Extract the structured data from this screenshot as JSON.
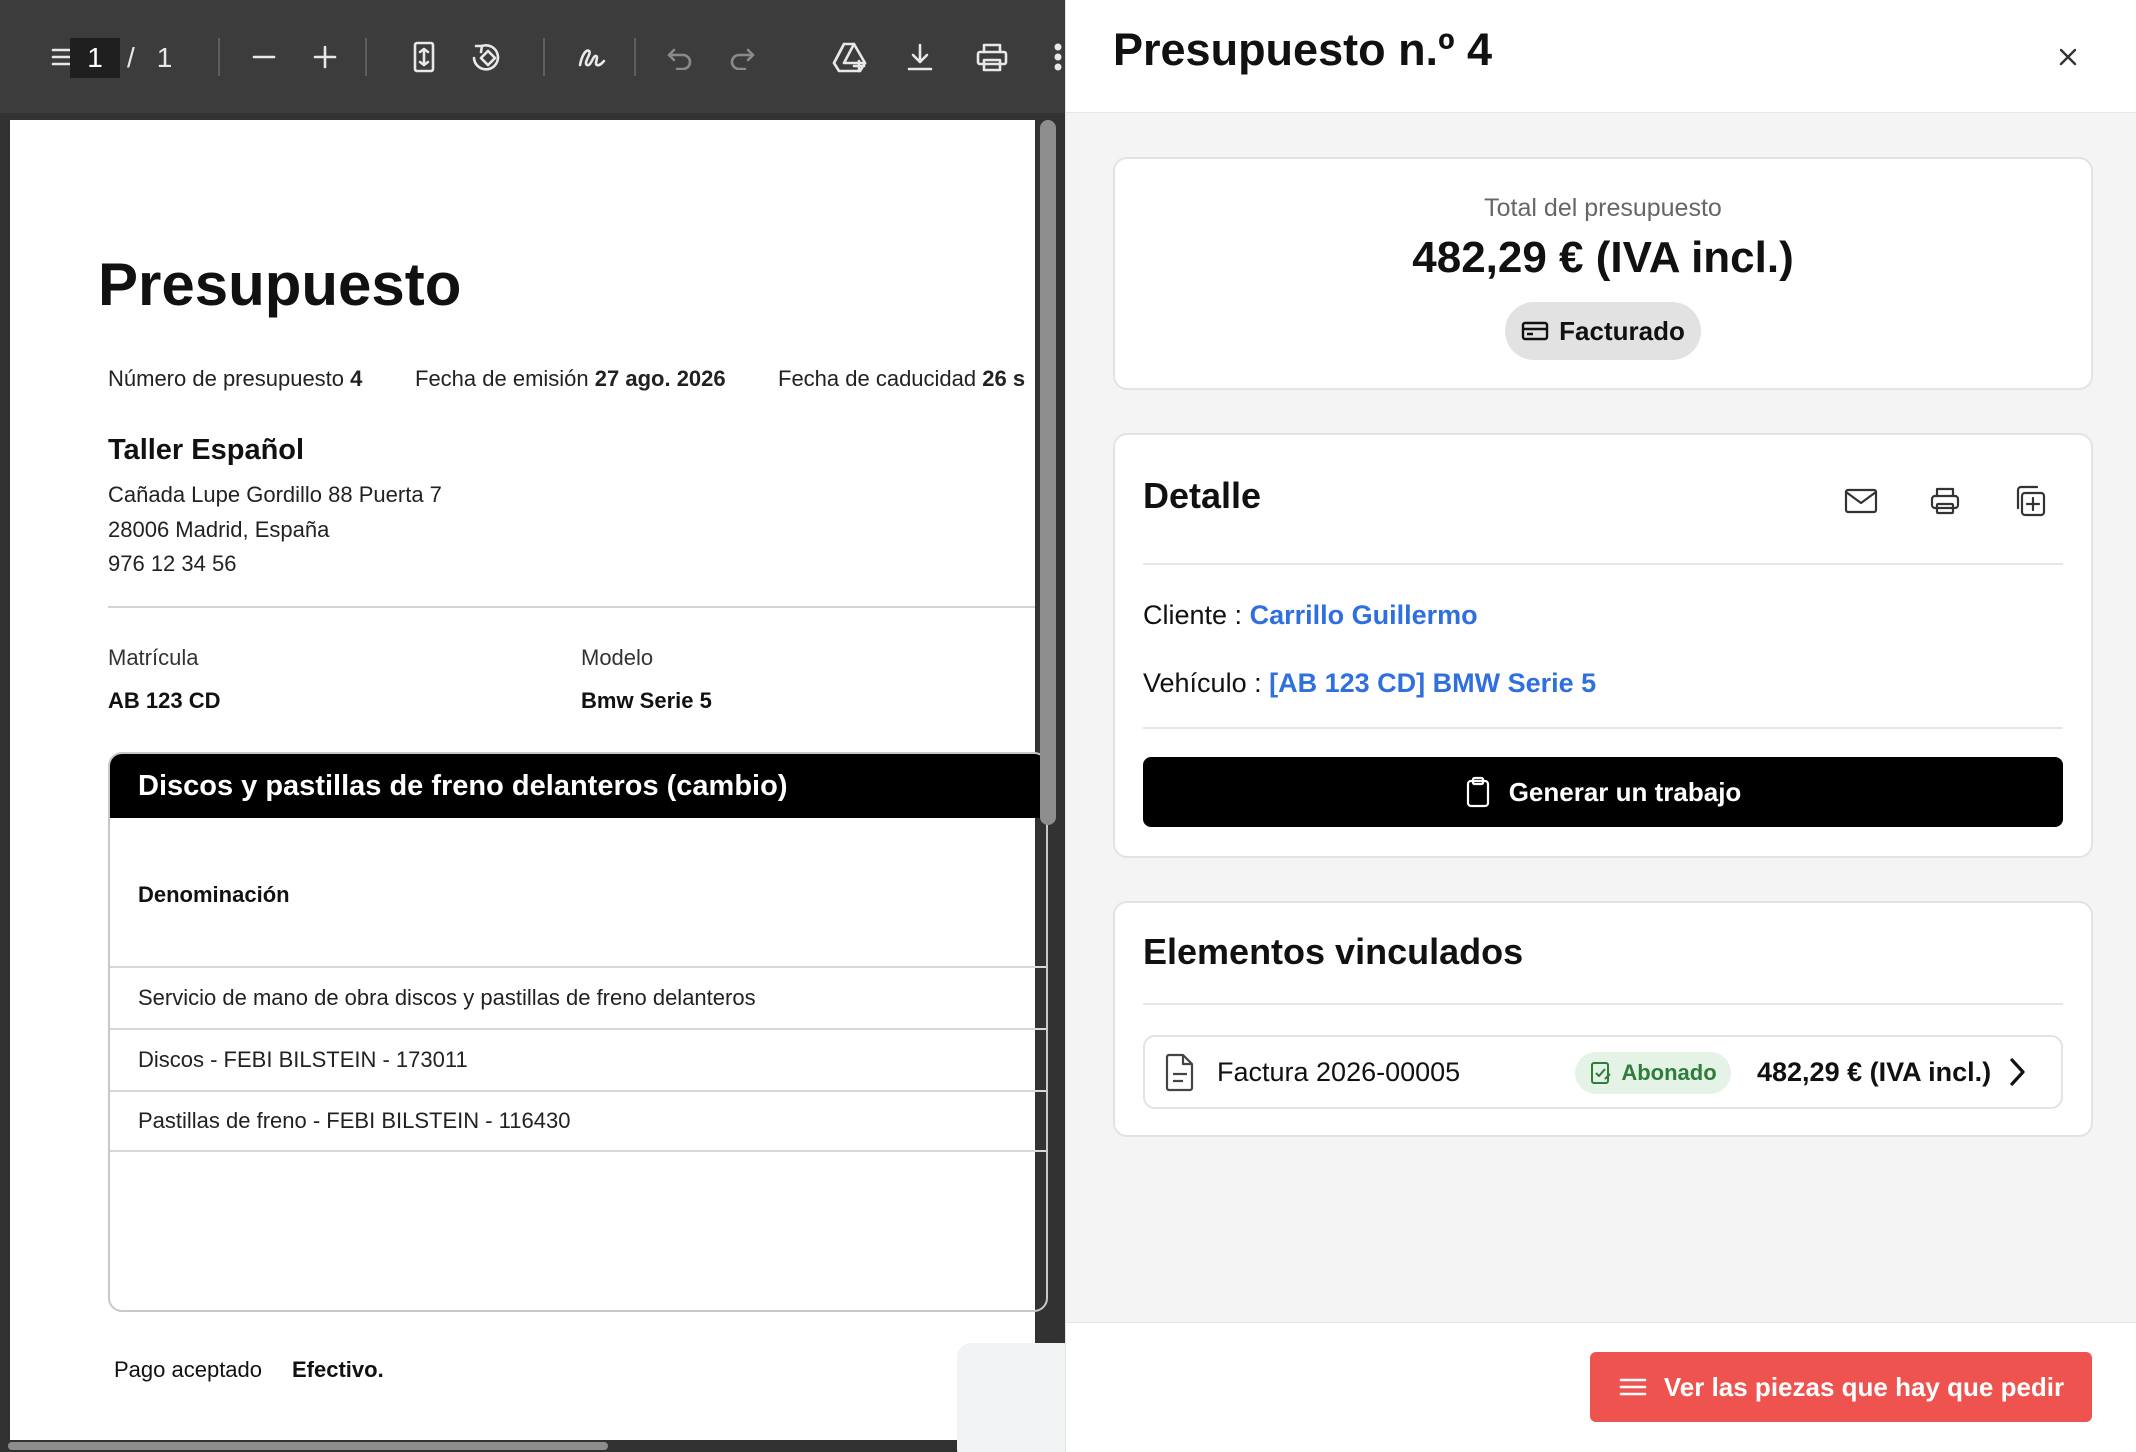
{
  "viewer": {
    "current_page": "1",
    "page_separator": "/",
    "total_pages": "1",
    "toolbar_icons": [
      "menu-icon",
      "zoom-out-icon",
      "zoom-in-icon",
      "fit-page-icon",
      "rotate-icon",
      "draw-icon",
      "undo-icon",
      "redo-icon",
      "drive-icon",
      "download-icon",
      "print-icon"
    ]
  },
  "pdf": {
    "title": "Presupuesto",
    "meta": {
      "number_label": "Número de presupuesto",
      "number_value": "4",
      "issue_label": "Fecha de emisión",
      "issue_value": "27 ago. 2026",
      "expiry_label": "Fecha de caducidad",
      "expiry_value": "26 s"
    },
    "company": {
      "name": "Taller Español",
      "address1": "Cañada Lupe Gordillo 88 Puerta 7",
      "address2": "28006 Madrid, España",
      "phone": "976 12 34 56"
    },
    "vehicle": {
      "plate_label": "Matrícula",
      "plate_value": "AB 123 CD",
      "model_label": "Modelo",
      "model_value": "Bmw Serie 5"
    },
    "operation": {
      "title": "Discos y pastillas de freno delanteros (cambio)",
      "column_header": "Denominación",
      "rows": [
        "Servicio de mano de obra discos y pastillas de freno delanteros",
        "Discos - FEBI BILSTEIN - 173011",
        "Pastillas de freno - FEBI BILSTEIN - 116430"
      ]
    },
    "payment": {
      "label": "Pago aceptado",
      "value": "Efectivo."
    }
  },
  "panel": {
    "title": "Presupuesto n.º 4",
    "total": {
      "label": "Total del presupuesto",
      "value": "482,29 € (IVA incl.)",
      "status": "Facturado"
    },
    "detail": {
      "title": "Detalle",
      "client_label": "Cliente :",
      "client_value": "Carrillo Guillermo",
      "vehicle_label": "Vehículo :",
      "vehicle_value": "[AB 123 CD] BMW Serie 5",
      "generate_button": "Generar un trabajo"
    },
    "linked": {
      "title": "Elementos vinculados",
      "items": [
        {
          "name": "Factura 2026-00005",
          "badge": "Abonado",
          "amount": "482,29 € (IVA incl.)"
        }
      ]
    },
    "footer_button": "Ver las piezas que hay que pedir"
  },
  "colors": {
    "link": "#2f6fde",
    "footer_button": "#ef5350",
    "badge_green_bg": "#e4f3e6",
    "badge_green_text": "#2f7d3a",
    "status_pill_bg": "#e2e2e2"
  }
}
